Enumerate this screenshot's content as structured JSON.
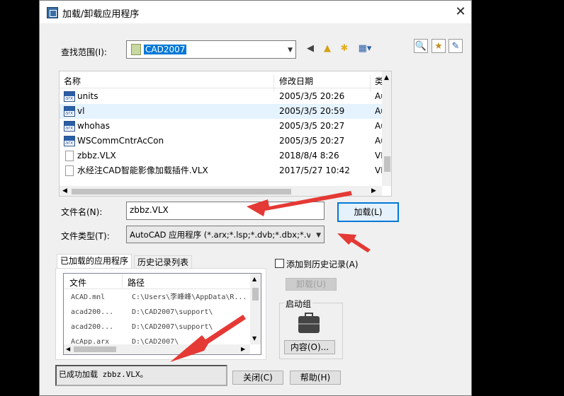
{
  "window": {
    "title": "加载/卸载应用程序"
  },
  "lookin": {
    "label": "查找范围(I):",
    "value": "CAD2007"
  },
  "filelist": {
    "columns": [
      "名称",
      "修改日期",
      "类型"
    ],
    "rows": [
      {
        "name": "units",
        "date": "2005/3/5 20:26",
        "type": "Auto",
        "icon": "arx-file-icon"
      },
      {
        "name": "vl",
        "date": "2005/3/5 20:59",
        "type": "Auto",
        "icon": "arx-file-icon"
      },
      {
        "name": "whohas",
        "date": "2005/3/5 20:27",
        "type": "Auto",
        "icon": "arx-file-icon"
      },
      {
        "name": "WSCommCntrAcCon",
        "date": "2005/3/5 20:27",
        "type": "Auto",
        "icon": "arx-file-icon"
      },
      {
        "name": "zbbz.VLX",
        "date": "2018/8/4 8:26",
        "type": "VLX",
        "icon": "vlx-file-icon"
      },
      {
        "name": "水经注CAD智能影像加载插件.VLX",
        "date": "2017/5/27 10:42",
        "type": "VLX",
        "icon": "vlx-file-icon"
      }
    ]
  },
  "filename": {
    "label": "文件名(N):",
    "value": "zbbz.VLX"
  },
  "filetype": {
    "label": "文件类型(T):",
    "value": "AutoCAD 应用程序 (*.arx;*.lsp;*.dvb;*.dbx;*.vlx"
  },
  "buttons": {
    "load": "加载(L)",
    "unload": "卸载(U)",
    "contents": "内容(O)...",
    "close": "关闭(C)",
    "help": "帮助(H)"
  },
  "tabs": [
    "已加载的应用程序",
    "历史记录列表"
  ],
  "loaded": {
    "columns": [
      "文件",
      "路径"
    ],
    "rows": [
      {
        "file": "ACAD.mnl",
        "path": "C:\\Users\\李峰峰\\AppData\\R..."
      },
      {
        "file": "acad200...",
        "path": "D:\\CAD2007\\support\\"
      },
      {
        "file": "acad200...",
        "path": "D:\\CAD2007\\support\\"
      },
      {
        "file": "AcApp.arx",
        "path": "D:\\CAD2007\\"
      }
    ]
  },
  "history_checkbox": {
    "label": "添加到历史记录(A)",
    "checked": false
  },
  "startup": {
    "label": "启动组"
  },
  "status": {
    "text": "已成功加载 zbbz.VLX。"
  },
  "colors": {
    "accent": "#0078d7",
    "annotation_arrow": "#e53935"
  }
}
